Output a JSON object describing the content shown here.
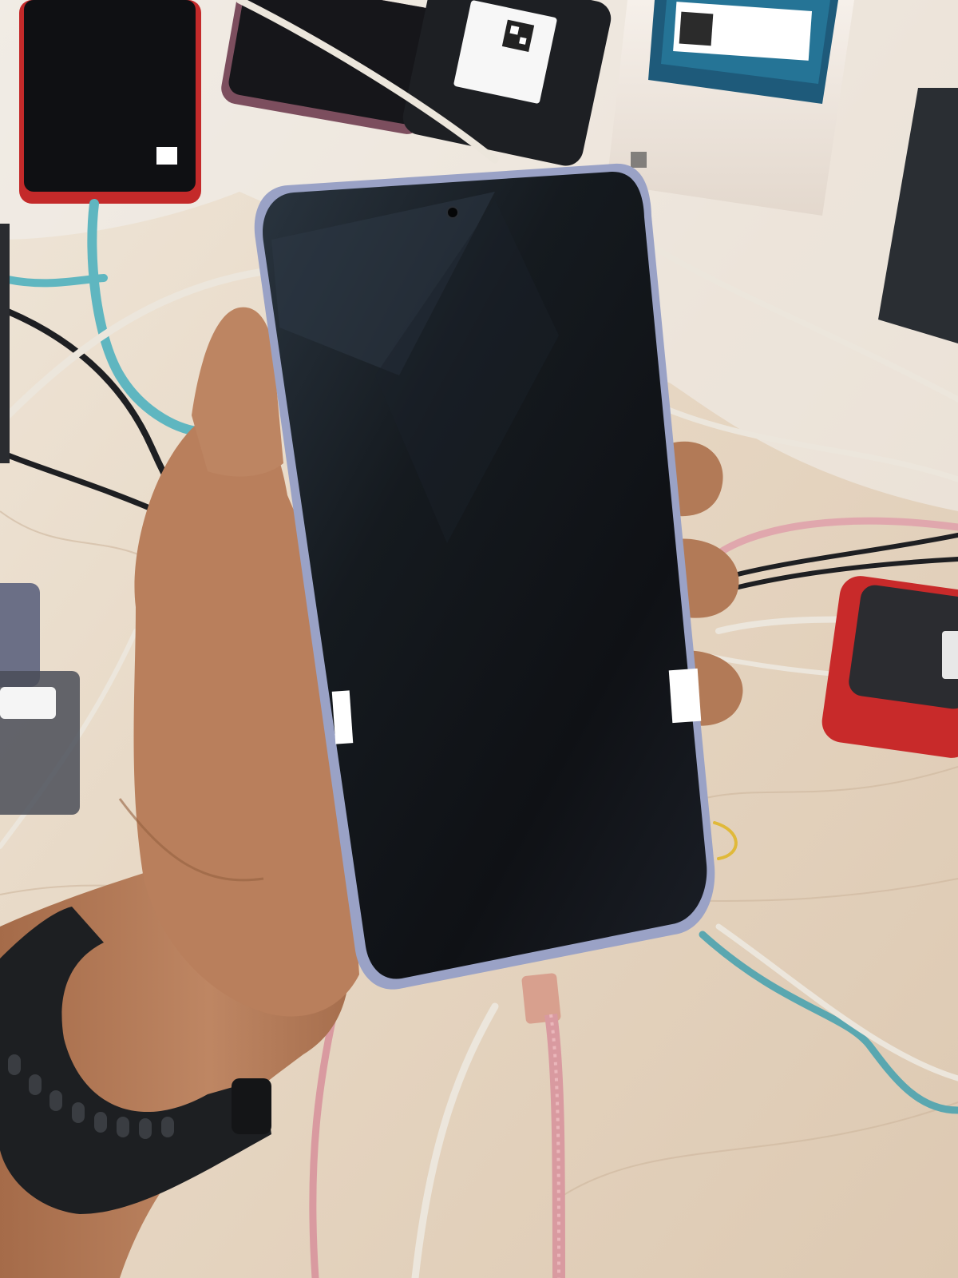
{
  "scene": {
    "colors": {
      "floor": "#e9dccb",
      "floor_marble": "#d9c7b2",
      "bubble_wrap": "#f2f0ee",
      "phone_frame": "#9aa2c6",
      "phone_screen": "#121417",
      "skin": "#b57c5a",
      "skin_shadow": "#8f5a3c",
      "watch": "#1d1f22",
      "pink_cable": "#d99aa0",
      "white_cable": "#ece6dc",
      "teal_cable": "#5aa7b0",
      "black_cable": "#1e1f22",
      "red_device": "#c82a2a",
      "box": "#efe7df",
      "sticker": "#ffffff"
    },
    "icons": [
      "phone",
      "hand",
      "wristwatch",
      "usb-cable",
      "qr-sticker",
      "phone-box",
      "power-strip"
    ]
  }
}
